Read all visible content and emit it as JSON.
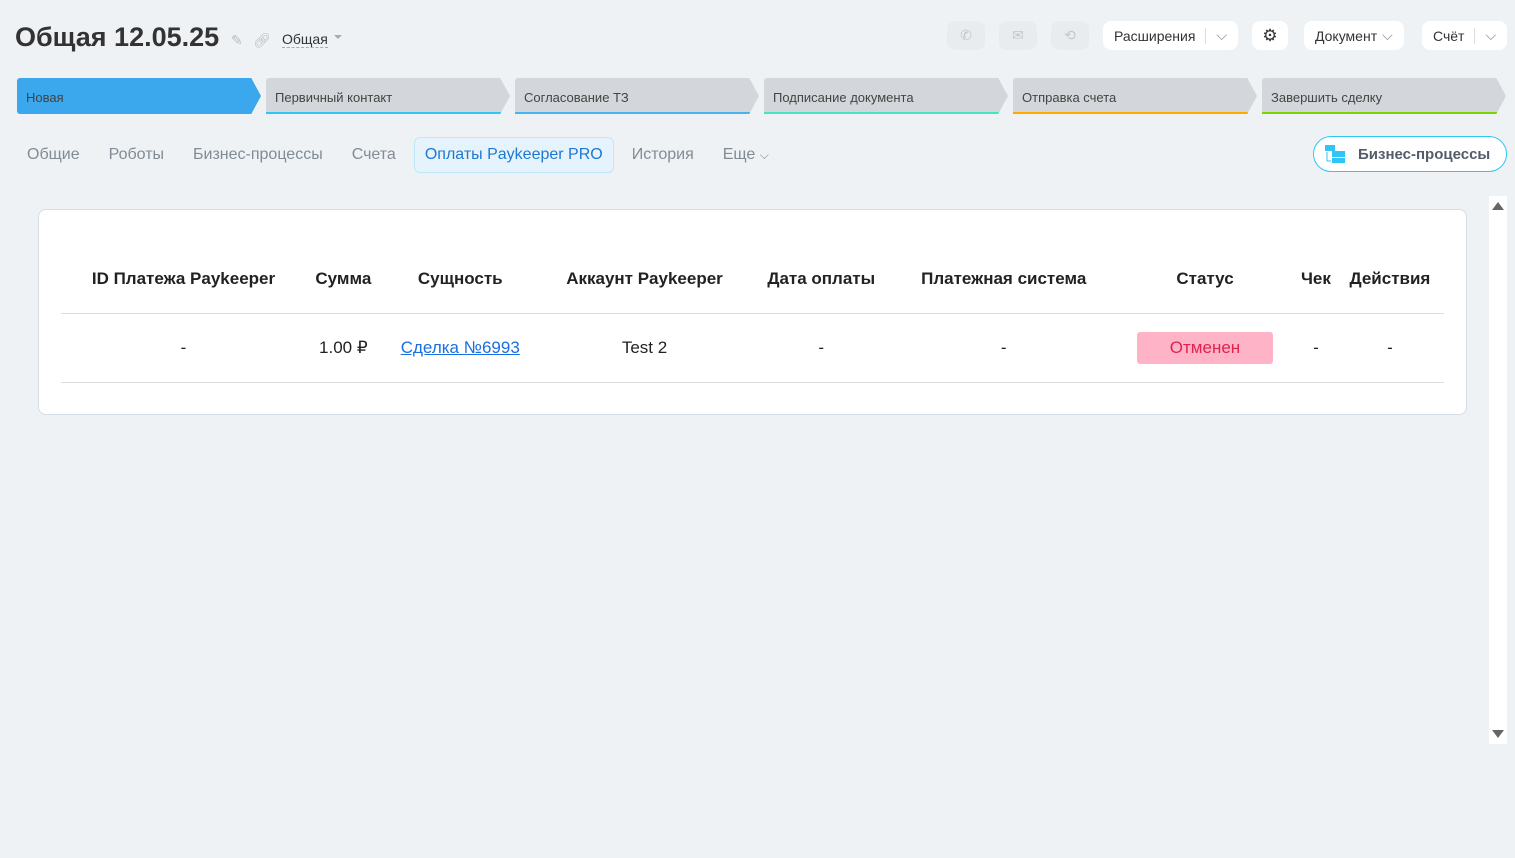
{
  "header": {
    "title": "Общая 12.05.25",
    "category": "Общая"
  },
  "toolbar": {
    "extensions": "Расширения",
    "document": "Документ",
    "invoice": "Счёт"
  },
  "stages": [
    {
      "label": "Новая",
      "color": "#3ba7ec"
    },
    {
      "label": "Первичный контакт",
      "color": "#2fc6f6"
    },
    {
      "label": "Согласование ТЗ",
      "color": "#47b4ee"
    },
    {
      "label": "Подписание документа",
      "color": "#47e4c2"
    },
    {
      "label": "Отправка счета",
      "color": "#ffa900"
    },
    {
      "label": "Завершить сделку",
      "color": "#7bd500"
    }
  ],
  "tabs": [
    "Общие",
    "Роботы",
    "Бизнес-процессы",
    "Счета",
    "Оплаты Paykeeper PRO",
    "История",
    "Еще"
  ],
  "bp_button": "Бизнес-процессы",
  "table": {
    "headers": [
      "ID Платежа Paykeeper",
      "Сумма",
      "Сущность",
      "Аккаунт Paykeeper",
      "Дата оплаты",
      "Платежная система",
      "Статус",
      "Чек",
      "Действия"
    ],
    "rows": [
      [
        "-",
        "1.00 ₽",
        "Сделка №6993",
        "Test 2",
        "-",
        "-",
        "Отменен",
        "-",
        "-"
      ]
    ]
  }
}
